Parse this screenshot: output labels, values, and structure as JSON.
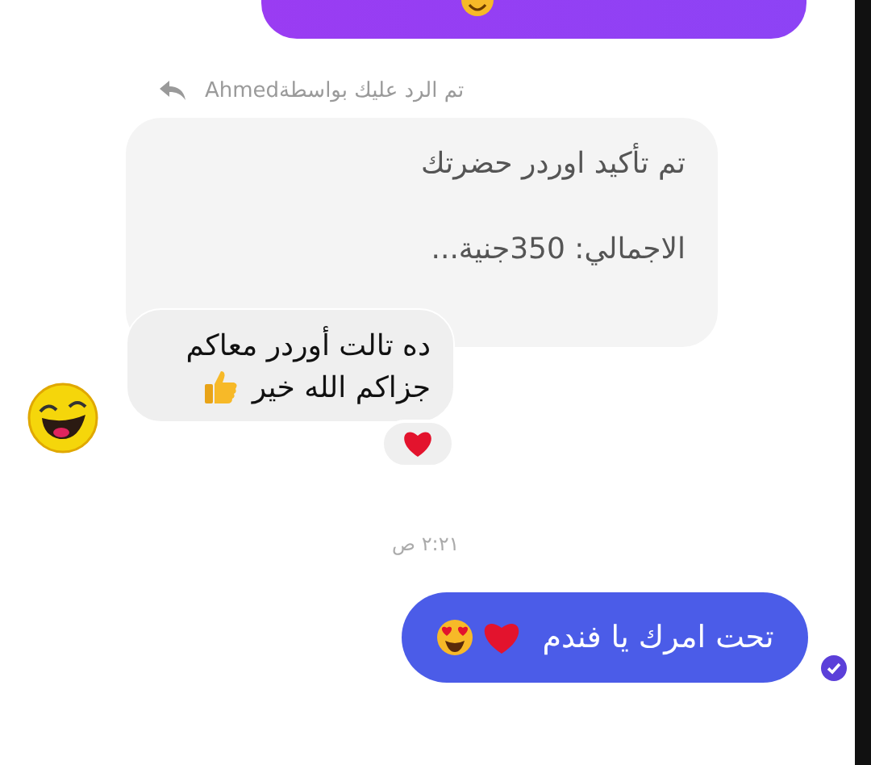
{
  "reply_note": "تم الرد عليك بواسطةAhmed",
  "quoted_message": {
    "lines": [
      "تم تأكيد اوردر حضرتك",
      "الاجمالي: 350جنية..."
    ]
  },
  "incoming_message": {
    "lines": [
      "ده تالت أوردر معاكم",
      "جزاكم الله خير"
    ],
    "reaction": true
  },
  "timestamp": "٢:٢١ ص",
  "outgoing_message": {
    "text": "تحت امرك يا فندم",
    "seen": true
  }
}
